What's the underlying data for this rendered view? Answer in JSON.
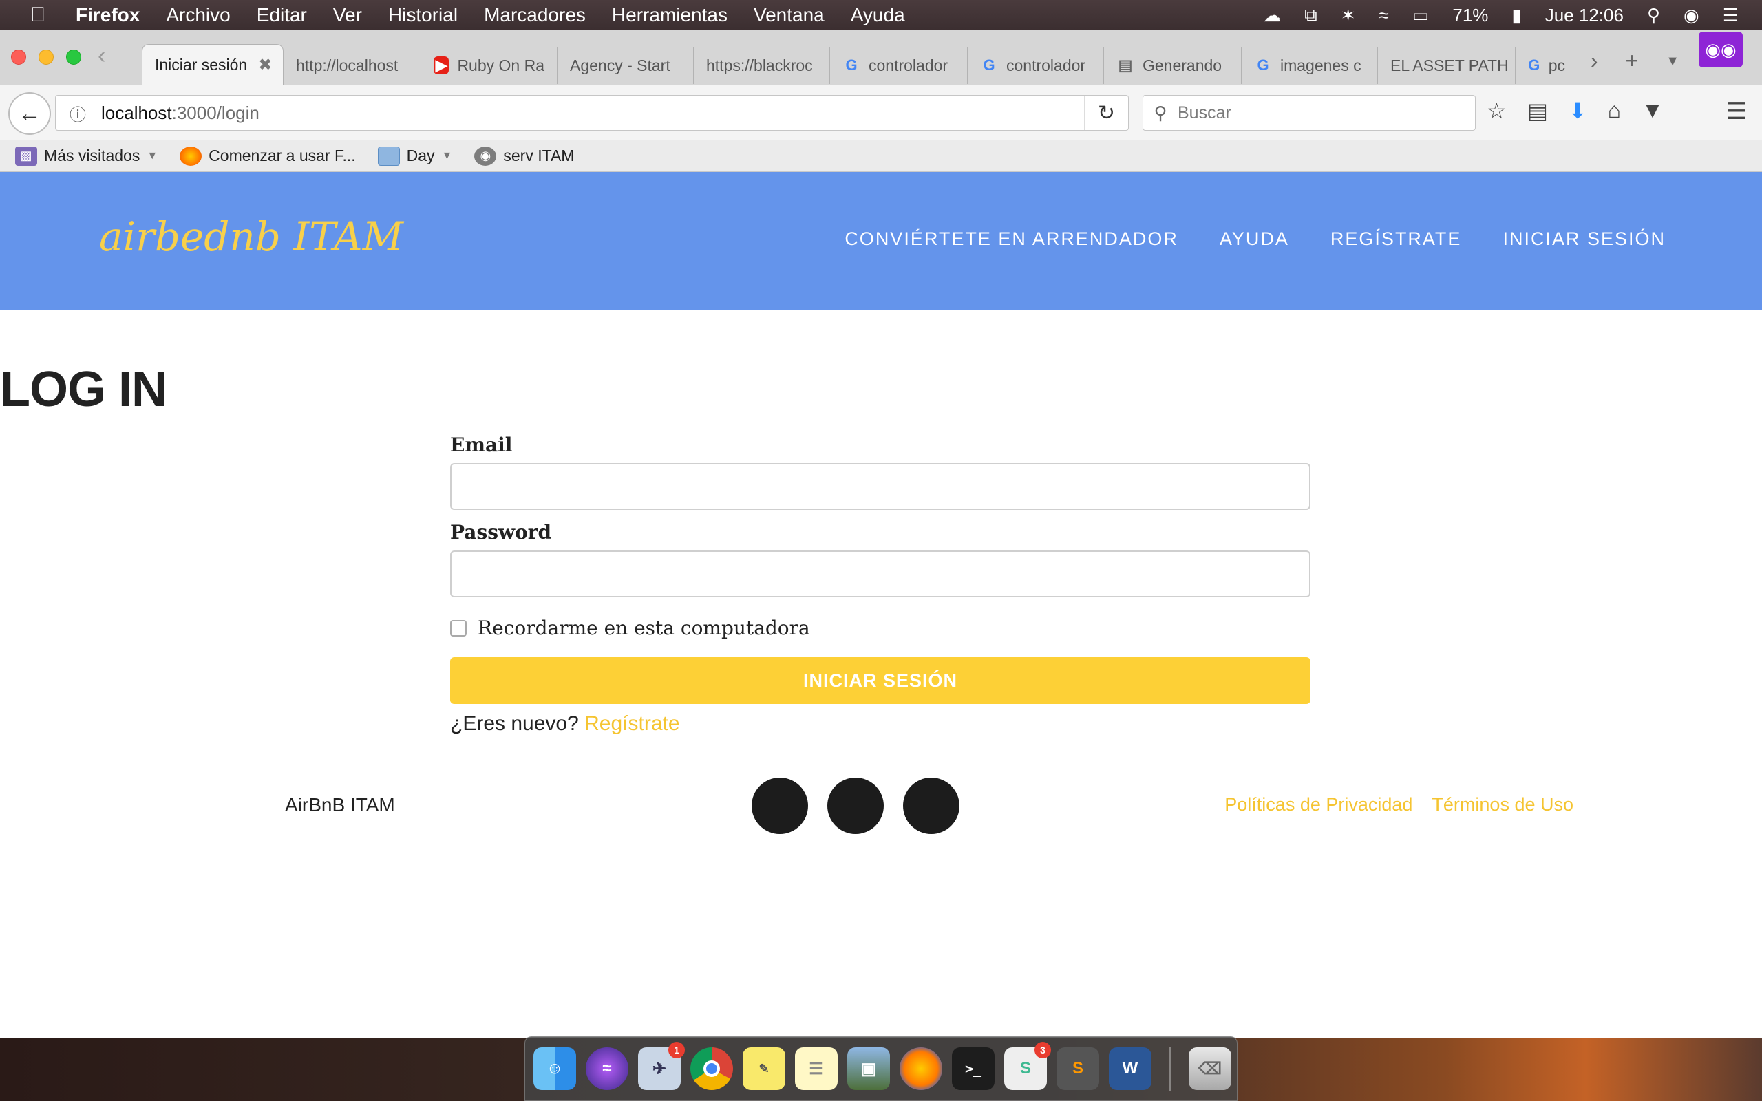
{
  "menubar": {
    "app_name": "Firefox",
    "items": [
      "Archivo",
      "Editar",
      "Ver",
      "Historial",
      "Marcadores",
      "Herramientas",
      "Ventana",
      "Ayuda"
    ],
    "battery": "71%",
    "clock": "Jue 12:06"
  },
  "tabs": [
    {
      "label": "Iniciar sesión",
      "icon": "none"
    },
    {
      "label": "http://localhost",
      "icon": "none"
    },
    {
      "label": "Ruby On Ra",
      "icon": "youtube-icon"
    },
    {
      "label": "Agency - Start",
      "icon": "none"
    },
    {
      "label": "https://blackroc",
      "icon": "none"
    },
    {
      "label": "controlador",
      "icon": "google-icon"
    },
    {
      "label": "controlador",
      "icon": "google-icon"
    },
    {
      "label": "Generando",
      "icon": "book-icon"
    },
    {
      "label": "imagenes c",
      "icon": "google-icon"
    },
    {
      "label": "EL ASSET PATH",
      "icon": "none"
    },
    {
      "label": "pc",
      "icon": "google-icon"
    }
  ],
  "navbar": {
    "url_host": "localhost",
    "url_path": ":3000/login",
    "search_placeholder": "Buscar"
  },
  "bookmarks": [
    {
      "label": "Más visitados",
      "icon": "most-visited-icon"
    },
    {
      "label": "Comenzar a usar F...",
      "icon": "firefox-icon"
    },
    {
      "label": "Day",
      "icon": "folder-icon"
    },
    {
      "label": "serv ITAM",
      "icon": "globe-icon"
    }
  ],
  "site": {
    "brand": "airbednb ITAM",
    "nav": [
      "CONVIÉRTETE EN ARRENDADOR",
      "AYUDA",
      "REGÍSTRATE",
      "INICIAR SESIÓN"
    ]
  },
  "login": {
    "title": "LOG IN",
    "email_label": "Email",
    "email_value": "",
    "password_label": "Password",
    "password_value": "",
    "remember_label": "Recordarme en esta computadora",
    "submit_label": "INICIAR SESIÓN",
    "new_user_prompt": "¿Eres nuevo?",
    "register_link": "Regístrate"
  },
  "footer": {
    "brand": "AirBnB ITAM",
    "links": [
      "Políticas de Privacidad",
      "Términos de Uso"
    ]
  },
  "dock": {
    "mail_badge": "1",
    "slack_badge": "3"
  },
  "colors": {
    "header_bg": "#6494eb",
    "brand_yellow": "#f8d04a",
    "button_yellow": "#fdd036",
    "link_yellow": "#f5c431"
  }
}
